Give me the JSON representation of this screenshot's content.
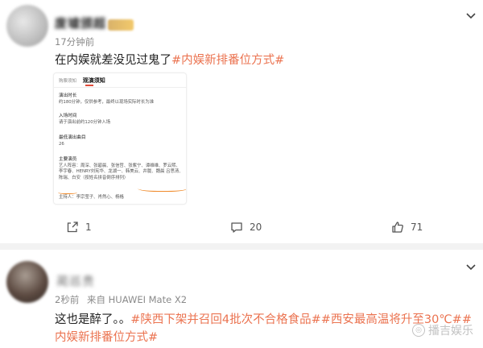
{
  "post1": {
    "author_name": "废墟颁超",
    "time": "17分钟前",
    "text_plain": "在内娱就差没见过鬼了",
    "hashtag": "#内娱新排番位方式#",
    "card": {
      "tab_inactive": "购票须知",
      "tab_active": "观演须知",
      "sections": [
        {
          "title": "演出时长",
          "body": "约180分钟，仅供参考，最终以现场实际时长为准"
        },
        {
          "title": "入场时间",
          "body": "请于演出前约120分钟入场"
        },
        {
          "title": "最低演出曲目",
          "body": "26"
        }
      ],
      "cast_title": "主要演员",
      "cast_body": "艺人阵容：周深、张碧晨、张信哲、张紫宁、谭维维、罗云熙、李宇春、HENRY刘宪华、龙湖一、韩美云、井胧、魏晨 吕思清、陈瑞、白安（按姓名拼音倒序排列）",
      "host": "主持人：李宗莹子、肖然心、杨格"
    },
    "actions": {
      "share_count": "1",
      "comment_count": "20",
      "like_count": "71"
    }
  },
  "post2": {
    "author_name": "蔺巡贵",
    "time": "2秒前",
    "source": "来自 HUAWEI Mate X2",
    "text_plain": "这也是醉了。。",
    "hashtags": [
      "#陕西下架并召回4批次不合格食品#",
      "#西安最高温将升至30℃#",
      "#内娱新排番位方式#"
    ]
  },
  "watermark": "播吉娱乐",
  "icons": {
    "chevron": "chevron-down-icon",
    "share": "share-icon",
    "comment": "comment-icon",
    "like": "thumbs-up-icon"
  },
  "colors": {
    "hashtag": "#eb7350",
    "meta": "#8a8a8a",
    "highlight": "#f08a2a"
  }
}
